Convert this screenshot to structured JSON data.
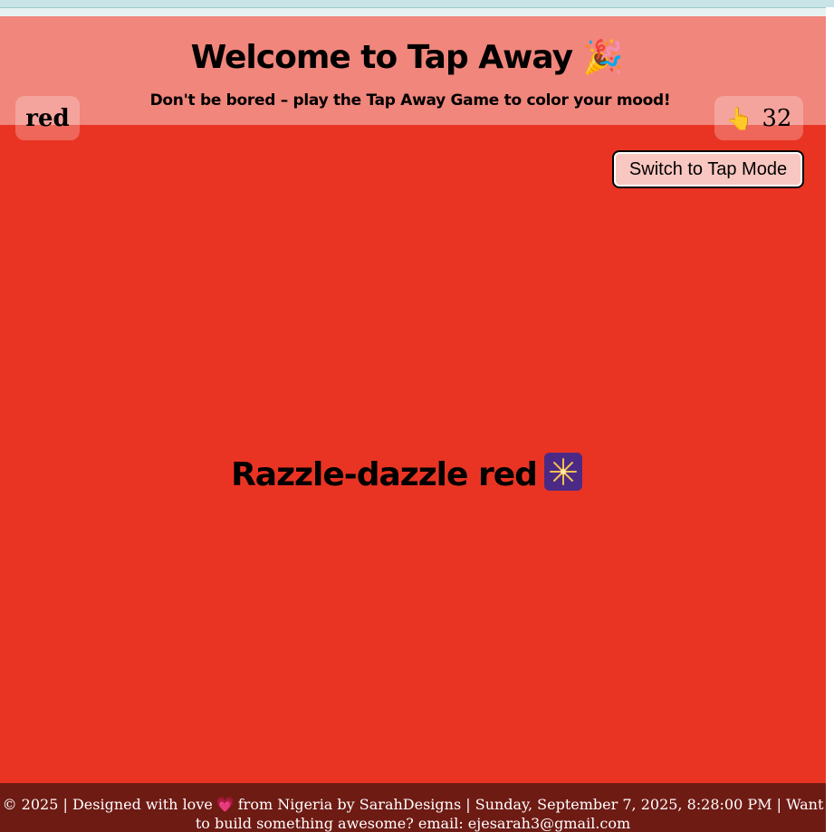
{
  "header": {
    "title": "Welcome to Tap Away",
    "title_emoji": "🎉",
    "subtitle": "Don't be bored – play the Tap Away Game to color your mood!"
  },
  "status": {
    "current_color": "red",
    "tap_icon": "👆",
    "tap_count": "32"
  },
  "controls": {
    "mode_button_label": "Switch to Tap Mode"
  },
  "main": {
    "mood_message": "Razzle-dazzle red",
    "mood_emoji": "🎆"
  },
  "footer": {
    "part1": "© 2025 | Designed with love",
    "heart": "💗",
    "part2": "from Nigeria by SarahDesigns | Sunday, September 7, 2025, 8:28:00 PM | Want to build something awesome? email: ejesarah3@gmail.com"
  },
  "colors": {
    "background": "#e93423",
    "header_overlay": "#f1867c",
    "footer": "#6e1b14",
    "button": "#f9c7c1"
  }
}
